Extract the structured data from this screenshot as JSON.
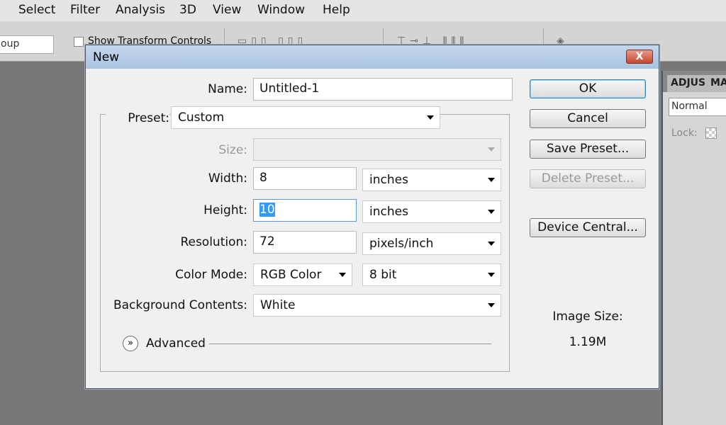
{
  "menu": [
    "Select",
    "Filter",
    "Analysis",
    "3D",
    "View",
    "Window",
    "Help"
  ],
  "options_bar": {
    "group_select": "oup",
    "show_transform_controls": "Show Transform Controls"
  },
  "panel": {
    "tabs": [
      "ADJUS",
      "MA"
    ],
    "blend_mode": "Normal",
    "lock_label": "Lock:"
  },
  "dialog": {
    "title": "New",
    "close_label": "X",
    "name_label": "Name:",
    "name_value": "Untitled-1",
    "preset_label": "Preset:",
    "preset_value": "Custom",
    "size_label": "Size:",
    "size_value": "",
    "width_label": "Width:",
    "width_value": "8",
    "width_unit": "inches",
    "height_label": "Height:",
    "height_value": "10",
    "height_unit": "inches",
    "resolution_label": "Resolution:",
    "resolution_value": "72",
    "resolution_unit": "pixels/inch",
    "color_mode_label": "Color Mode:",
    "color_mode_value": "RGB Color",
    "bit_depth": "8 bit",
    "background_label": "Background Contents:",
    "background_value": "White",
    "advanced_label": "Advanced",
    "buttons": {
      "ok": "OK",
      "cancel": "Cancel",
      "save_preset": "Save Preset...",
      "delete_preset": "Delete Preset...",
      "device_central": "Device Central..."
    },
    "image_size_label": "Image Size:",
    "image_size_value": "1.19M"
  }
}
